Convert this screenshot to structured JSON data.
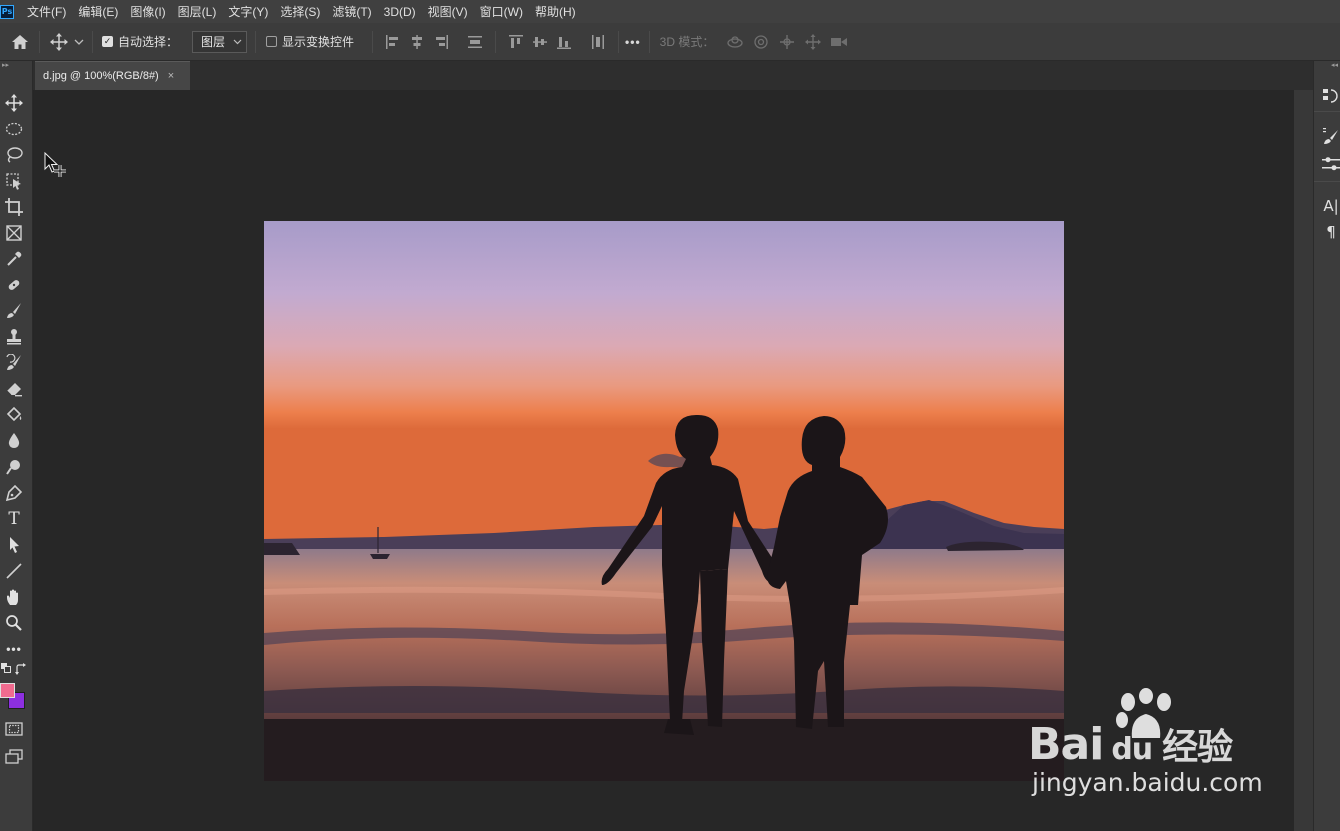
{
  "menubar": {
    "logo": "Ps",
    "items": [
      "文件(F)",
      "编辑(E)",
      "图像(I)",
      "图层(L)",
      "文字(Y)",
      "选择(S)",
      "滤镜(T)",
      "3D(D)",
      "视图(V)",
      "窗口(W)",
      "帮助(H)"
    ]
  },
  "options": {
    "auto_select_label": "自动选择：",
    "auto_select_checked": true,
    "auto_select_target": "图层",
    "show_transform_label": "显示变换控件",
    "show_transform_checked": false,
    "more_label": "•••",
    "mode_3d_label": "3D 模式："
  },
  "document": {
    "tab_title": "d.jpg @ 100%(RGB/8#)",
    "close_glyph": "×"
  },
  "tools": {
    "more_glyph": "•••",
    "type_tool_glyph": "T",
    "foreground_color": "#f16b8f",
    "background_color": "#8d2fe0"
  },
  "right_panel": {
    "character_glyph": "A|",
    "paragraph_glyph": "¶"
  },
  "watermark": {
    "logo_text": "Bai",
    "logo_paw_text": "du",
    "logo_cn": "经验",
    "url": "jingyan.baidu.com"
  }
}
